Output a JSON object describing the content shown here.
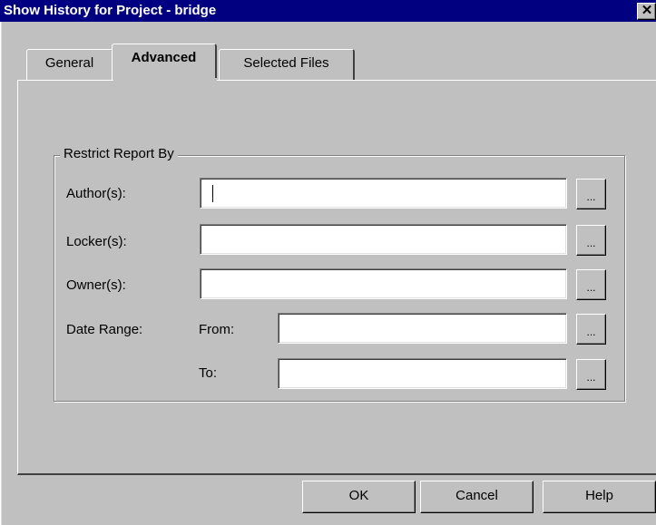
{
  "window": {
    "title": "Show History for Project - bridge",
    "close_glyph": "✕"
  },
  "tabs": [
    {
      "label": "General",
      "active": false
    },
    {
      "label": "Advanced",
      "active": true
    },
    {
      "label": "Selected Files",
      "active": false
    }
  ],
  "group": {
    "legend": "Restrict Report By",
    "authors_label": "Author(s):",
    "lockers_label": "Locker(s):",
    "owners_label": "Owner(s):",
    "date_range_label": "Date Range:",
    "from_label": "From:",
    "to_label": "To:",
    "authors_value": "",
    "lockers_value": "",
    "owners_value": "",
    "from_value": "",
    "to_value": "",
    "browse_label": "..."
  },
  "buttons": {
    "ok": "OK",
    "cancel": "Cancel",
    "help": "Help"
  }
}
